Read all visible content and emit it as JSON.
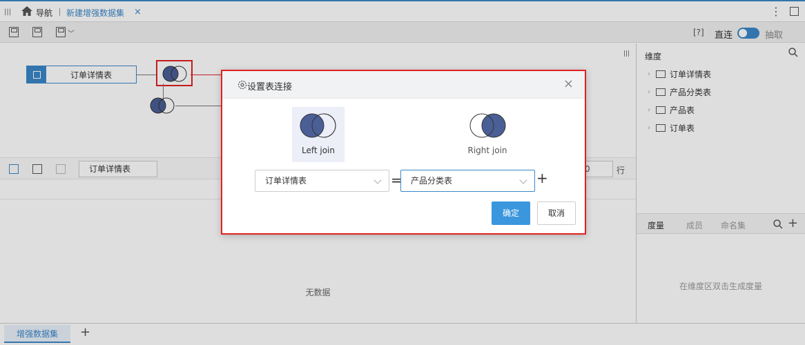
{
  "tabbar": {
    "nav_label": "导航",
    "active_tab": "新建增强数据集",
    "close": "×"
  },
  "toolbar": {
    "help": "[?]",
    "direct": "直连",
    "extract": "抽取"
  },
  "canvas": {
    "nodes": [
      {
        "label": "订单详情表"
      }
    ]
  },
  "subbar": {
    "table_chip": "订单详情表",
    "row_count": "0",
    "row_label": "行"
  },
  "datagrid": {
    "empty_text": "无数据"
  },
  "sidebar": {
    "dim_title": "维度",
    "tree": [
      {
        "label": "订单详情表"
      },
      {
        "label": "产品分类表"
      },
      {
        "label": "产品表"
      },
      {
        "label": "订单表"
      }
    ],
    "tabs": [
      {
        "label": "度量"
      },
      {
        "label": "成员"
      },
      {
        "label": "命名集"
      }
    ],
    "hint": "在维度区双击生成度量"
  },
  "bottom": {
    "tab": "增强数据集",
    "add": "+"
  },
  "dialog": {
    "title": "设置表连接",
    "close": "×",
    "left_join": "Left join",
    "right_join": "Right join",
    "left_table": "订单详情表",
    "right_table": "产品分类表",
    "equals": "=",
    "add": "+",
    "ok": "确定",
    "cancel": "取消"
  },
  "colors": {
    "accent": "#3a87c8",
    "highlight": "#e02020",
    "join_fill": "#4a5f96"
  }
}
